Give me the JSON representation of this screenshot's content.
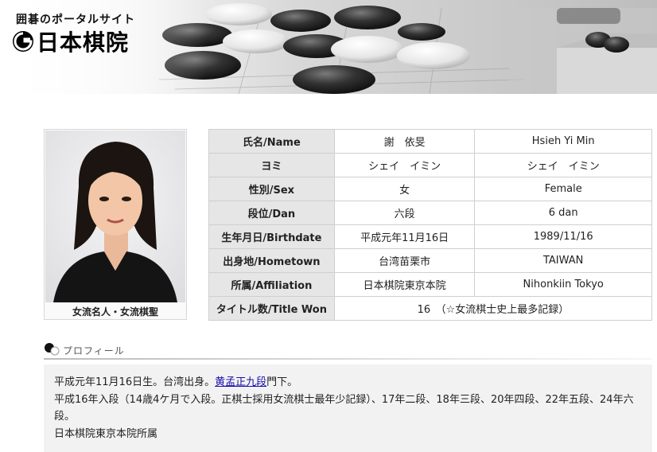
{
  "header": {
    "tagline": "囲碁のポータルサイト",
    "logo_text": "日本棋院"
  },
  "photo": {
    "caption": "女流名人・女流棋聖"
  },
  "profile_table": {
    "rows": [
      {
        "label": "氏名/Name",
        "jp": "謝　依旻",
        "en": "Hsieh Yi Min"
      },
      {
        "label": "ヨミ",
        "jp": "シェイ　イミン",
        "en": "シェイ　イミン"
      },
      {
        "label": "性別/Sex",
        "jp": "女",
        "en": "Female"
      },
      {
        "label": "段位/Dan",
        "jp": "六段",
        "en": "6 dan"
      },
      {
        "label": "生年月日/Birthdate",
        "jp": "平成元年11月16日",
        "en": "1989/11/16"
      },
      {
        "label": "出身地/Hometown",
        "jp": "台湾苗栗市",
        "en": "TAIWAN"
      },
      {
        "label": "所属/Affiliation",
        "jp": "日本棋院東京本院",
        "en": "Nihonkiin Tokyo"
      }
    ],
    "titles": {
      "label": "タイトル数/Title Won",
      "value": "16　（☆女流棋士史上最多記録）"
    }
  },
  "section": {
    "title": "プロフィール"
  },
  "bio": {
    "line1_before": "平成元年11月16日生。台湾出身。",
    "line1_link": "黄孟正九段",
    "line1_after": "門下。",
    "line2": "平成16年入段（14歳4ケ月で入段。正棋士採用女流棋士最年少記録）、17年二段、18年三段、20年四段、22年五段、24年六段。",
    "line3": "日本棋院東京本院所属"
  },
  "colors": {
    "label_bg": "#e6e6e6",
    "border": "#cfcfcf",
    "link": "#1a0dab",
    "bio_bg": "#f2f2f2"
  }
}
